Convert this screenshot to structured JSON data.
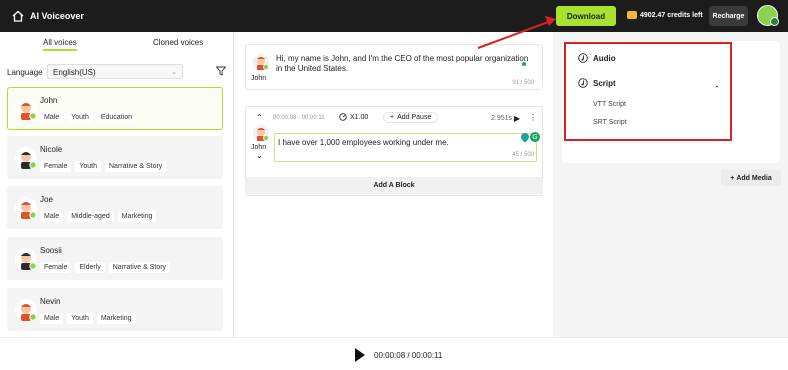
{
  "app": {
    "title": "AI Voiceover"
  },
  "topbar": {
    "download_label": "Download",
    "credits": "4902.47 credits left",
    "recharge_label": "Recharge"
  },
  "voices": {
    "tabs": [
      "All voices",
      "Cloned voices"
    ],
    "language_label": "Language",
    "language_value": "English(US)",
    "list": [
      {
        "name": "John",
        "tags": [
          "Male",
          "Youth",
          "Education"
        ],
        "selected": true
      },
      {
        "name": "Nicole",
        "tags": [
          "Female",
          "Youth",
          "Narrative & Story"
        ],
        "selected": false
      },
      {
        "name": "Joe",
        "tags": [
          "Male",
          "Middle-aged",
          "Marketing"
        ],
        "selected": false
      },
      {
        "name": "Soosii",
        "tags": [
          "Female",
          "Elderly",
          "Narrative & Story"
        ],
        "selected": false
      },
      {
        "name": "Nevin",
        "tags": [
          "Male",
          "Youth",
          "Marketing"
        ],
        "selected": false
      }
    ]
  },
  "editor": {
    "block1": {
      "speaker": "John",
      "text": "Hi, my name is John, and I'm the CEO of the most popular organization in the United States.",
      "count": "91 / 500"
    },
    "block2": {
      "speaker": "John",
      "time_range": "00:00:08 - 00:00:11",
      "speed": "X1.00",
      "add_pause": "Add Pause",
      "duration": "2.951s",
      "text": "I have over 1,000 employees working under me.",
      "count": "45 / 500"
    },
    "add_block_label": "Add A Block"
  },
  "download_menu": {
    "items": [
      {
        "label": "Audio",
        "icon": "music-note-icon"
      },
      {
        "label": "Script",
        "icon": "music-note-icon",
        "expanded": true,
        "children": [
          "VTT Script",
          "SRT Script"
        ]
      }
    ]
  },
  "media": {
    "add_media_label": "Add Media"
  },
  "player": {
    "time": "00:00:08 / 00:00:11"
  },
  "colors": {
    "accent": "#a6e22e",
    "annotation": "#d92127",
    "topbar": "#1c1c1c"
  }
}
